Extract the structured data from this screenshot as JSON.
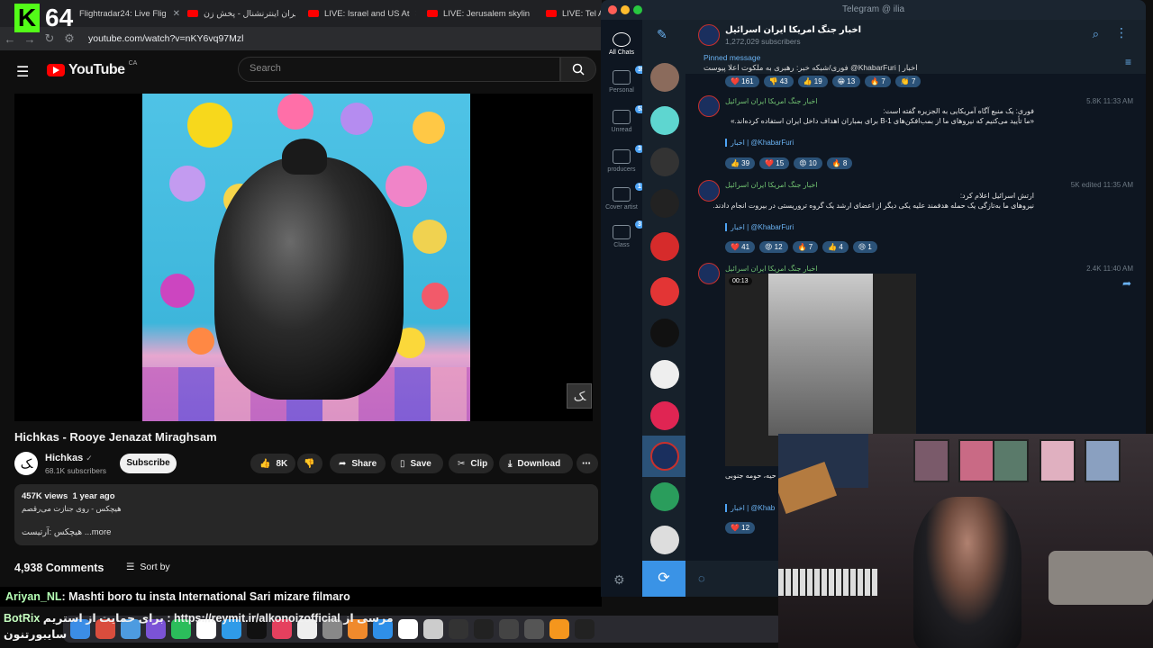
{
  "overlay": {
    "k_letter": "K",
    "number": "64"
  },
  "browser": {
    "tabs": [
      {
        "label": "Flightradar24: Live Flig"
      },
      {
        "label": "ایران اینترنشنال - پخش زن"
      },
      {
        "label": "LIVE: Israel and US At"
      },
      {
        "label": "LIVE: Jerusalem skylin"
      },
      {
        "label": "LIVE: Tel Av"
      }
    ],
    "url": "youtube.com/watch?v=nKY6vq97Mzl"
  },
  "youtube": {
    "logo_text": "YouTube",
    "region": "CA",
    "search_placeholder": "Search",
    "video": {
      "title": "Hichkas - Rooye Jenazat Miraghsam",
      "channel": "Hichkas",
      "subscribers": "68.1K subscribers",
      "subscribe_label": "Subscribe",
      "likes": "8K",
      "share_label": "Share",
      "save_label": "Save",
      "clip_label": "Clip",
      "download_label": "Download",
      "views": "457K views",
      "age": "1 year ago",
      "desc_line": "هیچکس - روی جنازت می‌رقصم",
      "more_line": "...more",
      "desc_prefix": "هیچکس :آرتیست",
      "comments": "4,938 Comments",
      "sort_label": "Sort by"
    }
  },
  "stream_chat": [
    {
      "user": "Ariyan_NL",
      "text": ": Mashti boro tu insta International Sari mizare filmaro"
    },
    {
      "user": "BotRix",
      "text": "برای حمایت از استریم : https://reymit.ir/alkonoizofficial مرسی از"
    },
    {
      "user": "",
      "text": "سایبورتنون"
    }
  ],
  "telegram": {
    "window_title": "Telegram @ ilia",
    "folders": [
      {
        "label": "All Chats",
        "badge": ""
      },
      {
        "label": "Personal",
        "badge": "397"
      },
      {
        "label": "Unread",
        "badge": "532"
      },
      {
        "label": "producers",
        "badge": "3"
      },
      {
        "label": "Cover artist",
        "badge": "1"
      },
      {
        "label": "Class",
        "badge": "3"
      }
    ],
    "channel": {
      "name": "اخبار جنگ امریکا ایران اسرائیل",
      "subscribers": "1,272,029 subscribers"
    },
    "pinned": {
      "title": "Pinned message",
      "text": "فوری/شبکه خبر: رهبری به ملکوت اعلا پیوست @KhabarFuri | اخبار"
    },
    "pinned_reactions": [
      "❤️ 161",
      "👎 43",
      "👍 19",
      "😁 13",
      "🔥 7",
      "👏 7"
    ],
    "messages": [
      {
        "sender": "اخبار جنگ امریکا ایران اسرائیل",
        "meta": "5.8K 11:33 AM",
        "text1": "فوری: یک منبع آگاه آمریکایی به الجزیره گفته است:",
        "text2": "«ما تأیید می‌کنیم که نیروهای ما از بمب‌افکن‌های B-1 برای بمباران اهداف داخل ایران استفاده کرده‌اند.»",
        "source": "اخبار | @KhabarFuri",
        "reactions": [
          "👍 39",
          "❤️ 15",
          "😡 10",
          "🔥 8"
        ]
      },
      {
        "sender": "اخبار جنگ امریکا ایران اسرائیل",
        "meta": "5K edited 11:35 AM",
        "text1": "ارتش اسرائیل اعلام کرد:",
        "text2": "نیروهای ما به‌تازگی یک حمله هدفمند علیه یکی دیگر از اعضای ارشد یک گروه تروریستی در بیروت انجام دادند.",
        "source": "اخبار | @KhabarFuri",
        "reactions": [
          "❤️ 41",
          "😡 12",
          "🔥 7",
          "👍 4",
          "😢 1"
        ]
      },
      {
        "sender": "اخبار جنگ امریکا ایران اسرائیل",
        "meta": "2.4K 11:40 AM",
        "duration": "00:13",
        "caption": "حیه، حومه جنوبی",
        "source": "اخبار | @Khab",
        "reactions": [
          "❤️ 12"
        ]
      }
    ]
  }
}
